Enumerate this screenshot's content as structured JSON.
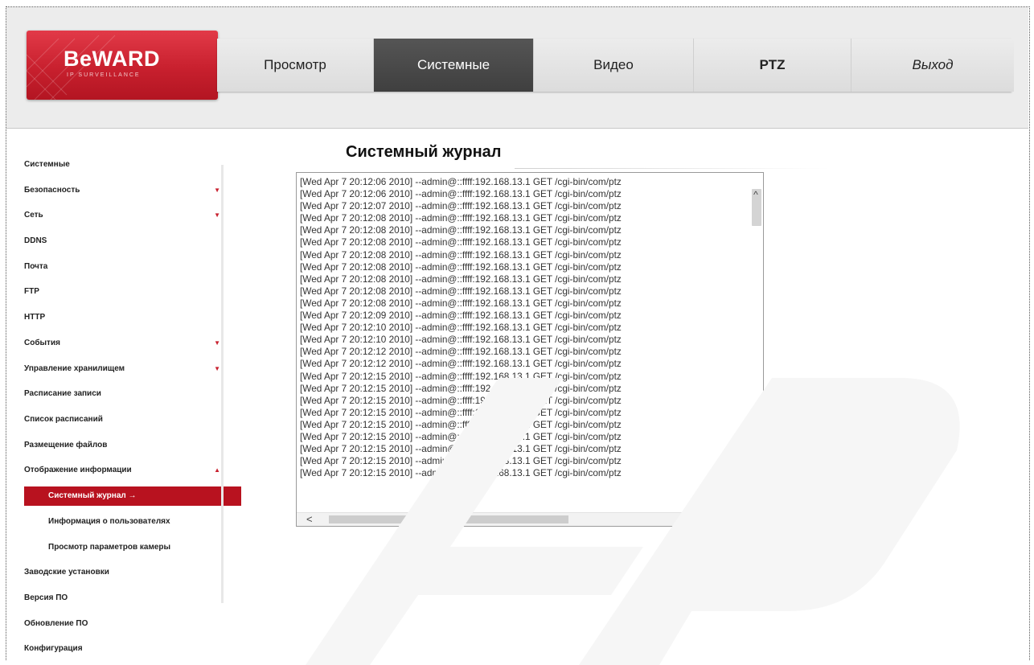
{
  "brand": {
    "logo_text": "BeWARD",
    "logo_sub": "IP SURVEILLANCE"
  },
  "nav": {
    "tabs": [
      {
        "label": "Просмотр",
        "active": false
      },
      {
        "label": "Системные",
        "active": true
      },
      {
        "label": "Видео",
        "active": false
      },
      {
        "label": "PTZ",
        "active": false
      },
      {
        "label": "Выход",
        "active": false
      }
    ]
  },
  "sidebar": {
    "items": [
      {
        "label": "Системные",
        "expand": ""
      },
      {
        "label": "Безопасность",
        "expand": "▼"
      },
      {
        "label": "Сеть",
        "expand": "▼"
      },
      {
        "label": "DDNS",
        "expand": ""
      },
      {
        "label": "Почта",
        "expand": ""
      },
      {
        "label": "FTP",
        "expand": ""
      },
      {
        "label": "HTTP",
        "expand": ""
      },
      {
        "label": "События",
        "expand": "▼"
      },
      {
        "label": "Управление хранилищем",
        "expand": "▼"
      },
      {
        "label": "Расписание записи",
        "expand": ""
      },
      {
        "label": "Список расписаний",
        "expand": ""
      },
      {
        "label": "Размещение файлов",
        "expand": ""
      },
      {
        "label": "Отображение информации",
        "expand": "▲"
      },
      {
        "label": "Системный журнал",
        "expand": ""
      },
      {
        "label": "Информация о пользователях",
        "expand": ""
      },
      {
        "label": "Просмотр параметров камеры",
        "expand": ""
      },
      {
        "label": "Заводские установки",
        "expand": ""
      },
      {
        "label": "Версия ПО",
        "expand": ""
      },
      {
        "label": "Обновление ПО",
        "expand": ""
      },
      {
        "label": "Конфигурация",
        "expand": ""
      }
    ],
    "active_arrow": "→"
  },
  "main": {
    "title": "Системный журнал",
    "log": [
      "[Wed Apr  7 20:12:06 2010] --admin@::ffff:192.168.13.1 GET /cgi-bin/com/ptz",
      "[Wed Apr  7 20:12:06 2010] --admin@::ffff:192.168.13.1 GET /cgi-bin/com/ptz",
      "[Wed Apr  7 20:12:07 2010] --admin@::ffff:192.168.13.1 GET /cgi-bin/com/ptz",
      "[Wed Apr  7 20:12:08 2010] --admin@::ffff:192.168.13.1 GET /cgi-bin/com/ptz",
      "[Wed Apr  7 20:12:08 2010] --admin@::ffff:192.168.13.1 GET /cgi-bin/com/ptz",
      "[Wed Apr  7 20:12:08 2010] --admin@::ffff:192.168.13.1 GET /cgi-bin/com/ptz",
      "[Wed Apr  7 20:12:08 2010] --admin@::ffff:192.168.13.1 GET /cgi-bin/com/ptz",
      "[Wed Apr  7 20:12:08 2010] --admin@::ffff:192.168.13.1 GET /cgi-bin/com/ptz",
      "[Wed Apr  7 20:12:08 2010] --admin@::ffff:192.168.13.1 GET /cgi-bin/com/ptz",
      "[Wed Apr  7 20:12:08 2010] --admin@::ffff:192.168.13.1 GET /cgi-bin/com/ptz",
      "[Wed Apr  7 20:12:08 2010] --admin@::ffff:192.168.13.1 GET /cgi-bin/com/ptz",
      "[Wed Apr  7 20:12:09 2010] --admin@::ffff:192.168.13.1 GET /cgi-bin/com/ptz",
      "[Wed Apr  7 20:12:10 2010] --admin@::ffff:192.168.13.1 GET /cgi-bin/com/ptz",
      "[Wed Apr  7 20:12:10 2010] --admin@::ffff:192.168.13.1 GET /cgi-bin/com/ptz",
      "[Wed Apr  7 20:12:12 2010] --admin@::ffff:192.168.13.1 GET /cgi-bin/com/ptz",
      "[Wed Apr  7 20:12:12 2010] --admin@::ffff:192.168.13.1 GET /cgi-bin/com/ptz",
      "[Wed Apr  7 20:12:15 2010] --admin@::ffff:192.168.13.1 GET /cgi-bin/com/ptz",
      "[Wed Apr  7 20:12:15 2010] --admin@::ffff:192.168.13.1 GET /cgi-bin/com/ptz",
      "[Wed Apr  7 20:12:15 2010] --admin@::ffff:192.168.13.1 GET /cgi-bin/com/ptz",
      "[Wed Apr  7 20:12:15 2010] --admin@::ffff:192.168.13.1 GET /cgi-bin/com/ptz",
      "[Wed Apr  7 20:12:15 2010] --admin@::ffff:192.168.13.1 GET /cgi-bin/com/ptz",
      "[Wed Apr  7 20:12:15 2010] --admin@::ffff:192.168.13.1 GET /cgi-bin/com/ptz",
      "[Wed Apr  7 20:12:15 2010] --admin@::ffff:192.168.13.1 GET /cgi-bin/com/ptz",
      "[Wed Apr  7 20:12:15 2010] --admin@::ffff:192.168.13.1 GET /cgi-bin/com/ptz",
      "[Wed Apr  7 20:12:15 2010] --admin@::ffff:192.168.13.1 GET /cgi-bin/com/ptz"
    ],
    "scroll_icons": {
      "up": "^",
      "down": "∨",
      "left": "<",
      "right": ">"
    }
  },
  "colors": {
    "brand_red": "#c8202e",
    "nav_active": "#474747",
    "nav_bg": "#e2e2e2"
  }
}
